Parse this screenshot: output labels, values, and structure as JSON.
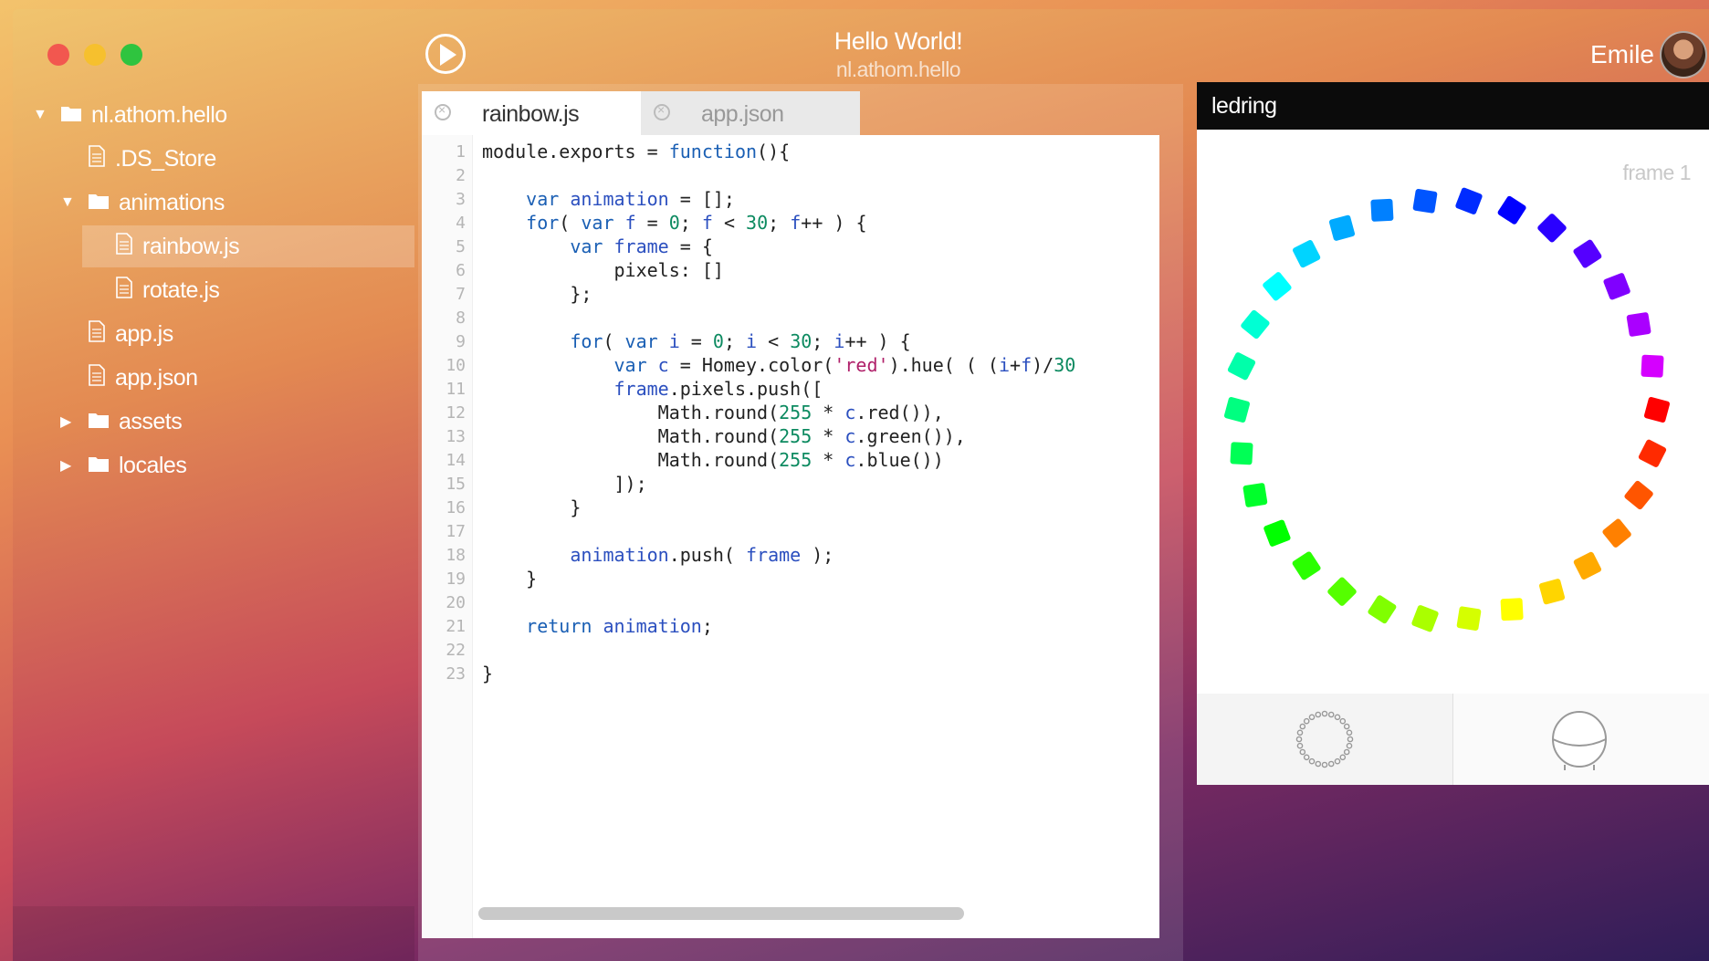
{
  "window": {
    "title": "Hello World!",
    "subtitle": "nl.athom.hello",
    "user_name": "Emile"
  },
  "sidebar": {
    "items": [
      {
        "label": "nl.athom.hello",
        "type": "folder",
        "expanded": true
      },
      {
        "label": ".DS_Store",
        "type": "file"
      },
      {
        "label": "animations",
        "type": "folder",
        "expanded": true
      },
      {
        "label": "rainbow.js",
        "type": "file",
        "selected": true
      },
      {
        "label": "rotate.js",
        "type": "file"
      },
      {
        "label": "app.js",
        "type": "file"
      },
      {
        "label": "app.json",
        "type": "file"
      },
      {
        "label": "assets",
        "type": "folder",
        "expanded": false
      },
      {
        "label": "locales",
        "type": "folder",
        "expanded": false
      }
    ]
  },
  "editor": {
    "tabs": [
      {
        "label": "rainbow.js",
        "active": true
      },
      {
        "label": "app.json",
        "active": false
      }
    ],
    "line_numbers": [
      "1",
      "2",
      "3",
      "4",
      "5",
      "6",
      "7",
      "8",
      "9",
      "10",
      "11",
      "12",
      "13",
      "14",
      "15",
      "16",
      "17",
      "18",
      "19",
      "20",
      "21",
      "22",
      "23"
    ],
    "lines": [
      "module.exports = function(){",
      "",
      "    var animation = [];",
      "    for( var f = 0; f < 30; f++ ) {",
      "        var frame = {",
      "            pixels: []",
      "        };",
      "",
      "        for( var i = 0; i < 30; i++ ) {",
      "            var c = Homey.color('red').hue( ( (i+f)/30",
      "            frame.pixels.push([",
      "                Math.round(255 * c.red()),",
      "                Math.round(255 * c.green()),",
      "                Math.round(255 * c.blue())",
      "            ]);",
      "        }",
      "",
      "        animation.push( frame );",
      "    }",
      "",
      "    return animation;",
      "",
      "}"
    ]
  },
  "preview": {
    "title": "ledring",
    "frame_label": "frame 1",
    "led_count": 30,
    "icons": [
      "led-ring-icon",
      "homey-device-icon"
    ]
  },
  "colors": {
    "editor_keyword": "#1a5fb4",
    "editor_number": "#0c8a60",
    "editor_string": "#b0206a",
    "panel_header": "#0b0b0b"
  }
}
